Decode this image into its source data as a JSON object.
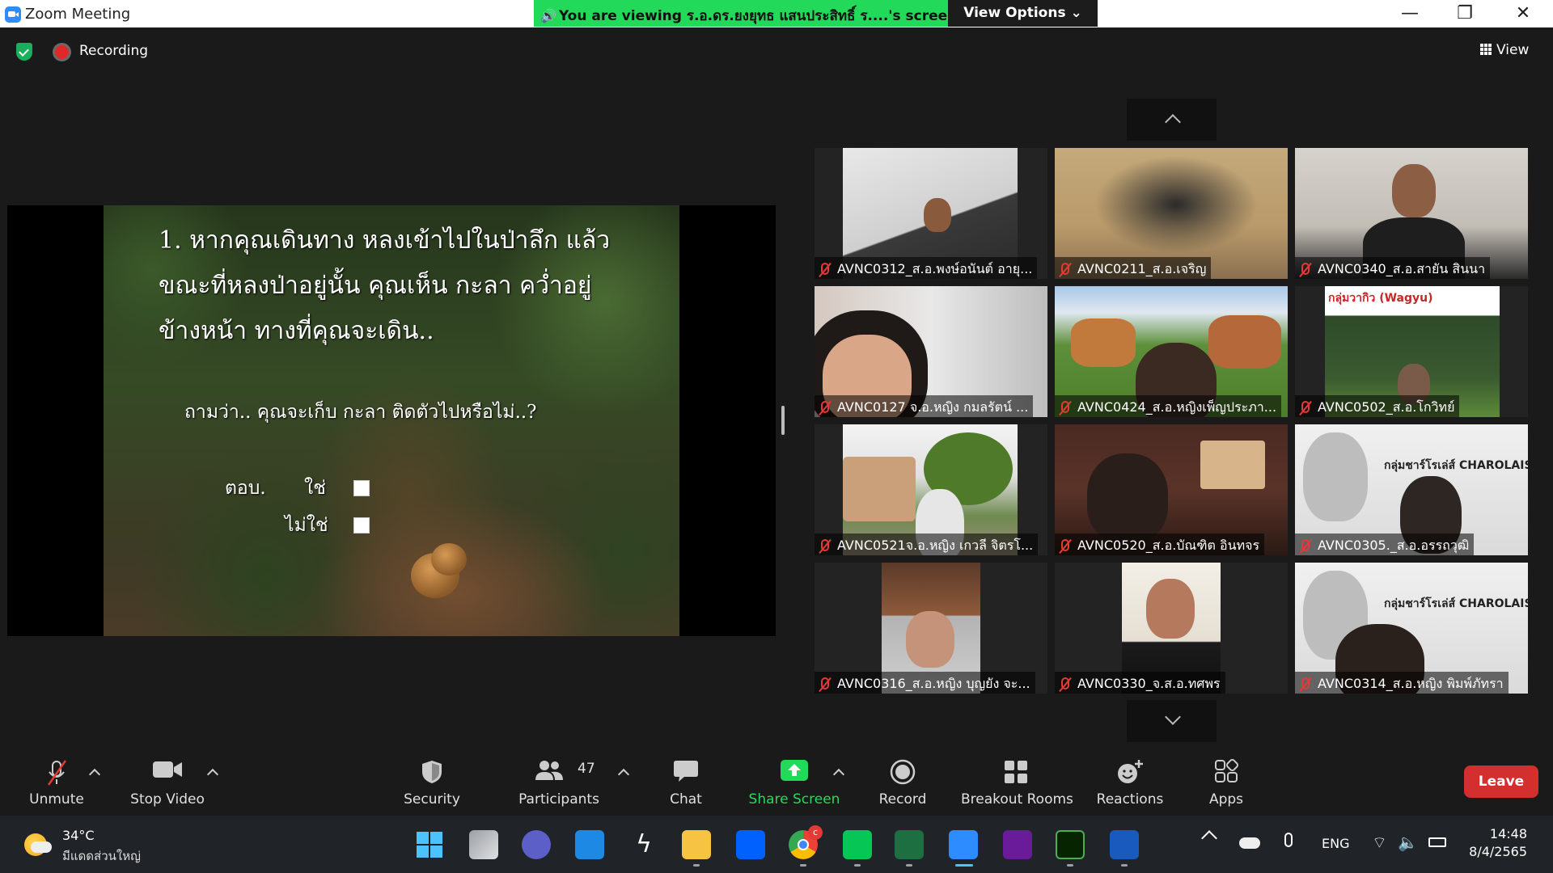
{
  "window": {
    "title": "Zoom Meeting",
    "minimize": "—",
    "maximize": "❐",
    "close": "✕"
  },
  "banner": {
    "text": "You are viewing ร.อ.ดร.ยงยุทธ แสนประสิทธิ์ ร....'s screen",
    "view_options": "View Options ⌄"
  },
  "topbar": {
    "recording": "Recording",
    "view": "View"
  },
  "slide": {
    "lines": [
      "1. หากคุณเดินทาง หลงเข้าไปในป่าลึก แล้ว",
      "ขณะที่หลงป่าอยู่นั้น คุณเห็น กะลา คว่ำอยู่",
      "ข้างหน้า ทางที่คุณจะเดิน..",
      "ถามว่า.. คุณจะเก็บ กะลา ติดตัวไปหรือไม่..?"
    ],
    "answer_label": "ตอบ.",
    "option_yes": "ใช่",
    "option_no": "ไม่ใช่"
  },
  "participants": [
    {
      "name": "AVNC0312_ส.อ.พงษ์อนันต์ อายุ..."
    },
    {
      "name": "AVNC0211_ส.อ.เจริญ"
    },
    {
      "name": "AVNC0340_ส.อ.สายัน สินนา"
    },
    {
      "name": "AVNC0127 จ.อ.หญิง กมลรัตน์ ..."
    },
    {
      "name": "AVNC0424_ส.อ.หญิงเพ็ญประภา..."
    },
    {
      "name": "AVNC0502_ส.อ.โกวิทย์",
      "bg_text": "กลุ่มวากิว (Wagyu)"
    },
    {
      "name": "AVNC0521จ.อ.หญิง เกวลี จิตรโ..."
    },
    {
      "name": "AVNC0520_ส.อ.บัณฑิต อินทจร"
    },
    {
      "name": "AVNC0305._ส.อ.อรรถวุฒิ",
      "bg_text": "กลุ่มชาร์โรเล่ส์ CHAROLAIS"
    },
    {
      "name": "AVNC0316_ส.อ.หญิง บุญยัง จะ..."
    },
    {
      "name": "AVNC0330_จ.ส.อ.ทศพร"
    },
    {
      "name": "AVNC0314_ส.อ.หญิง พิมพ์ภัทรา",
      "bg_text": "กลุ่มชาร์โรเล่ส์ CHAROLAIS"
    }
  ],
  "toolbar": {
    "unmute": "Unmute",
    "stop_video": "Stop Video",
    "security": "Security",
    "participants": "Participants",
    "participant_count": "47",
    "chat": "Chat",
    "share_screen": "Share Screen",
    "record": "Record",
    "breakout_rooms": "Breakout Rooms",
    "reactions": "Reactions",
    "apps": "Apps",
    "leave": "Leave"
  },
  "taskbar": {
    "temperature": "34°C",
    "weather": "มีแดดส่วนใหญ่",
    "language": "ENG",
    "time": "14:48",
    "date": "8/4/2565",
    "chrome_badge": "c"
  },
  "colors": {
    "accent_green": "#23d959",
    "leave_red": "#d32f2f",
    "mute_red": "#e53935",
    "zoom_blue": "#2d8cff"
  }
}
